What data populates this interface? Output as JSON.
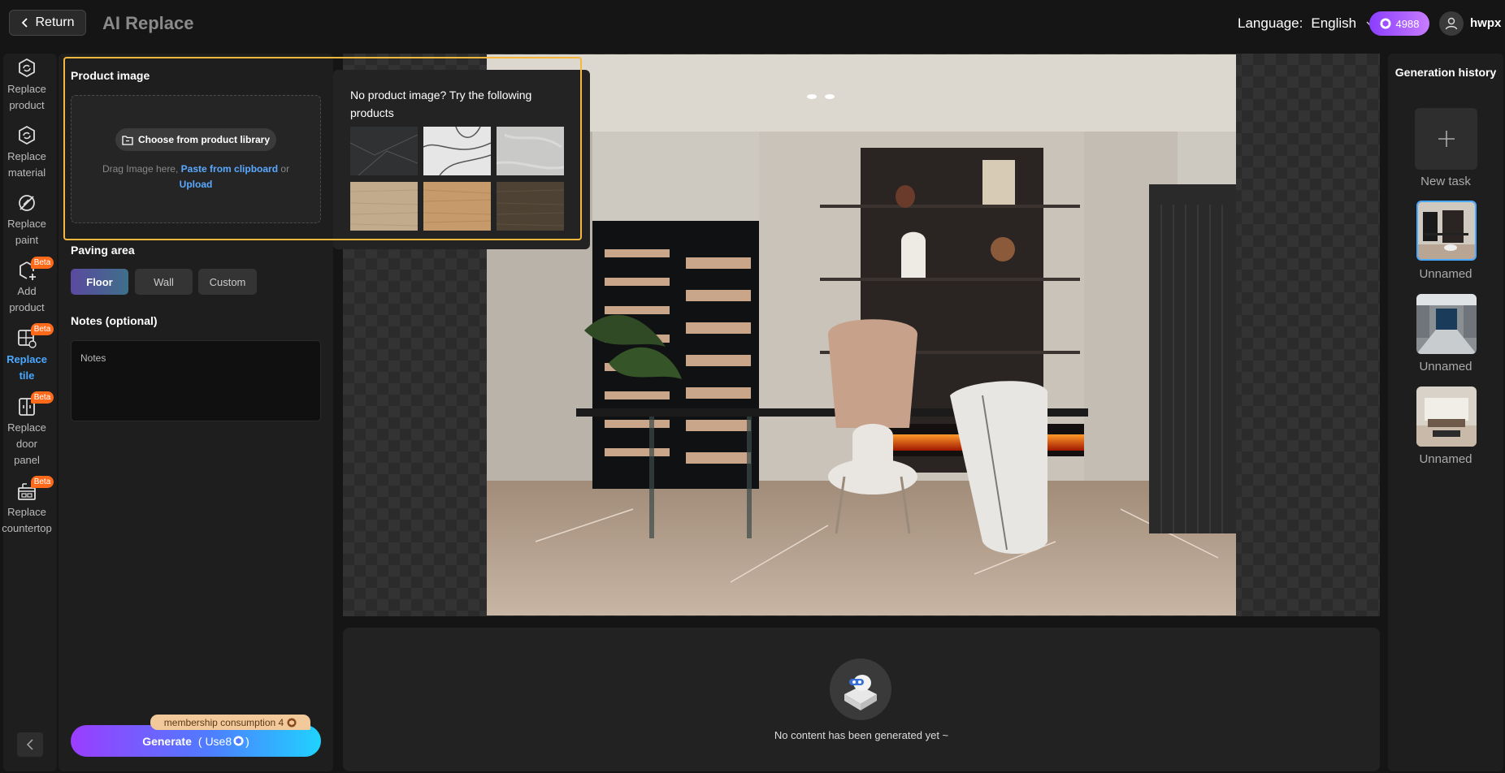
{
  "header": {
    "return_label": "Return",
    "title": "AI Replace",
    "language_label": "Language:",
    "language_value": "English",
    "credits": "4988",
    "username": "hwpx"
  },
  "nav": {
    "items": [
      {
        "label": "Replace product",
        "beta": false
      },
      {
        "label": "Replace material",
        "beta": false
      },
      {
        "label": "Replace paint",
        "beta": false
      },
      {
        "label": "Add product",
        "beta": true
      },
      {
        "label": "Replace tile",
        "beta": true,
        "active": true
      },
      {
        "label": "Replace door panel",
        "beta": true
      },
      {
        "label": "Replace countertop",
        "beta": true
      }
    ],
    "beta_label": "Beta"
  },
  "panel": {
    "product_image_title": "Product image",
    "choose_label": "Choose from product library",
    "drag_text": "Drag Image here,",
    "paste_link": "Paste from clipboard",
    "or_text": "or",
    "upload_link": "Upload",
    "paving_title": "Paving area",
    "paving_options": [
      "Floor",
      "Wall",
      "Custom"
    ],
    "paving_selected": "Floor",
    "notes_title": "Notes (optional)",
    "notes_placeholder": "Notes",
    "membership_label": "membership consumption 4",
    "generate_label": "Generate",
    "generate_use": "( Use8",
    "generate_use_close": ")"
  },
  "suggest": {
    "title": "No product image? Try the following products",
    "swatches": [
      {
        "name": "dark-marble",
        "color": "#2f3133"
      },
      {
        "name": "white-marble",
        "color": "#dedede"
      },
      {
        "name": "grey-stone",
        "color": "#c9c9c7"
      },
      {
        "name": "light-oak",
        "color": "#c2ab8c"
      },
      {
        "name": "natural-oak",
        "color": "#c69a6a"
      },
      {
        "name": "dark-walnut",
        "color": "#4e4234"
      }
    ]
  },
  "result": {
    "empty_text": "No content has been generated yet ~"
  },
  "history": {
    "title": "Generation history",
    "new_task_label": "New task",
    "items": [
      {
        "label": "Unnamed",
        "active": true
      },
      {
        "label": "Unnamed",
        "active": false
      },
      {
        "label": "Unnamed",
        "active": false
      }
    ]
  },
  "colors": {
    "accent": "#4aa8ff",
    "highlight": "#f6b73c",
    "beta": "#ff6a1a"
  }
}
